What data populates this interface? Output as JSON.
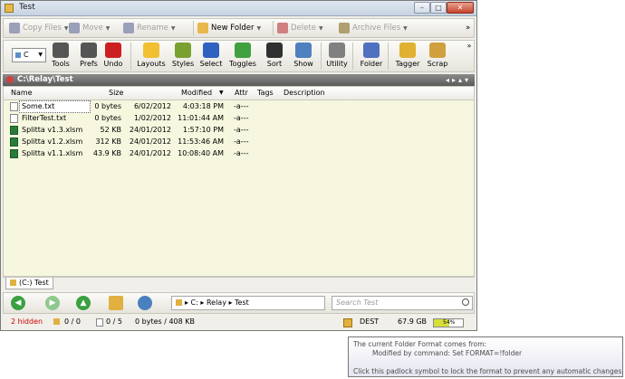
{
  "window": {
    "title": "Test",
    "min": "–",
    "max": "□",
    "close": "✕"
  },
  "toolbar1": [
    {
      "label": "Copy Files",
      "icon": "copy-files-icon",
      "color": "#9aa0b8",
      "active": false
    },
    {
      "label": "Move",
      "icon": "move-icon",
      "color": "#9aa0b8",
      "active": false
    },
    {
      "label": "Rename",
      "icon": "rename-icon",
      "color": "#9aa0b8",
      "active": false
    },
    {
      "label": "New Folder",
      "icon": "new-folder-icon",
      "color": "#e8b84a",
      "active": true
    },
    {
      "label": "Delete",
      "icon": "delete-icon",
      "color": "#d08080",
      "active": false
    },
    {
      "label": "Archive Files",
      "icon": "archive-files-icon",
      "color": "#b0a070",
      "active": false
    }
  ],
  "toolbar1_overflow": "»",
  "toolbar2": {
    "drive": "C",
    "tools": [
      {
        "label": "Tools",
        "icon": "gear-icon",
        "color": "#555555"
      },
      {
        "label": "Prefs",
        "icon": "prefs-gear-icon",
        "color": "#555555"
      },
      {
        "label": "Undo",
        "icon": "undo-icon",
        "color": "#cc2020"
      },
      {
        "label": "Layouts",
        "icon": "layouts-icon",
        "color": "#f0c030"
      },
      {
        "label": "Styles",
        "icon": "styles-icon",
        "color": "#7aa030"
      },
      {
        "label": "Select",
        "icon": "select-icon",
        "color": "#3060c0"
      },
      {
        "label": "Toggles",
        "icon": "toggles-icon",
        "color": "#40a040"
      },
      {
        "label": "Sort",
        "icon": "sort-icon",
        "color": "#303030"
      },
      {
        "label": "Show",
        "icon": "show-icon",
        "color": "#5080c0"
      },
      {
        "label": "Utility",
        "icon": "utility-icon",
        "color": "#808080"
      },
      {
        "label": "Folder",
        "icon": "folder-icon",
        "color": "#5070c0"
      },
      {
        "label": "Tagger",
        "icon": "tagger-icon",
        "color": "#e0b030"
      },
      {
        "label": "Scrap",
        "icon": "scrap-icon",
        "color": "#d0a040"
      }
    ],
    "overflow": "»"
  },
  "path": {
    "text": "C:\\Relay\\Test",
    "arrows": "◂▸▴▾"
  },
  "columns": {
    "name": "Name",
    "size": "Size",
    "modified": "Modified",
    "attr": "Attr",
    "tags": "Tags",
    "description": "Description"
  },
  "files": [
    {
      "name": "Some.txt",
      "size": "0 bytes",
      "date": "6/02/2012",
      "time": "4:03:18 PM",
      "attr": "-a---",
      "type": "txt"
    },
    {
      "name": "FilterTest.txt",
      "size": "0 bytes",
      "date": "1/02/2012",
      "time": "11:01:44 AM",
      "attr": "-a---",
      "type": "txt"
    },
    {
      "name": "Splitta v1.3.xlsm",
      "size": "52 KB",
      "date": "24/01/2012",
      "time": "1:57:10 PM",
      "attr": "-a---",
      "type": "xls"
    },
    {
      "name": "Splitta v1.2.xlsm",
      "size": "312 KB",
      "date": "24/01/2012",
      "time": "11:53:46 AM",
      "attr": "-a---",
      "type": "xls"
    },
    {
      "name": "Splitta v1.1.xlsm",
      "size": "43.9 KB",
      "date": "24/01/2012",
      "time": "10:08:40 AM",
      "attr": "-a---",
      "type": "xls"
    }
  ],
  "tab": {
    "label": "(C:) Test"
  },
  "breadcrumb": {
    "text": "▸  C:  ▸  Relay  ▸  Test"
  },
  "search": {
    "placeholder": "Search Test"
  },
  "status": {
    "hidden": "2 hidden",
    "folders": "0 / 0",
    "files": "0 / 5",
    "bytes": "0 bytes / 408 KB",
    "dest": "DEST",
    "free": "67.9 GB",
    "usage_pct": 54,
    "usage_label": "54%"
  },
  "tooltip": {
    "line1": "The current Folder Format comes from:",
    "line2": "Modified by command: Set FORMAT=!folder",
    "line3": "Click this padlock symbol to lock the format to prevent any automatic changes."
  }
}
